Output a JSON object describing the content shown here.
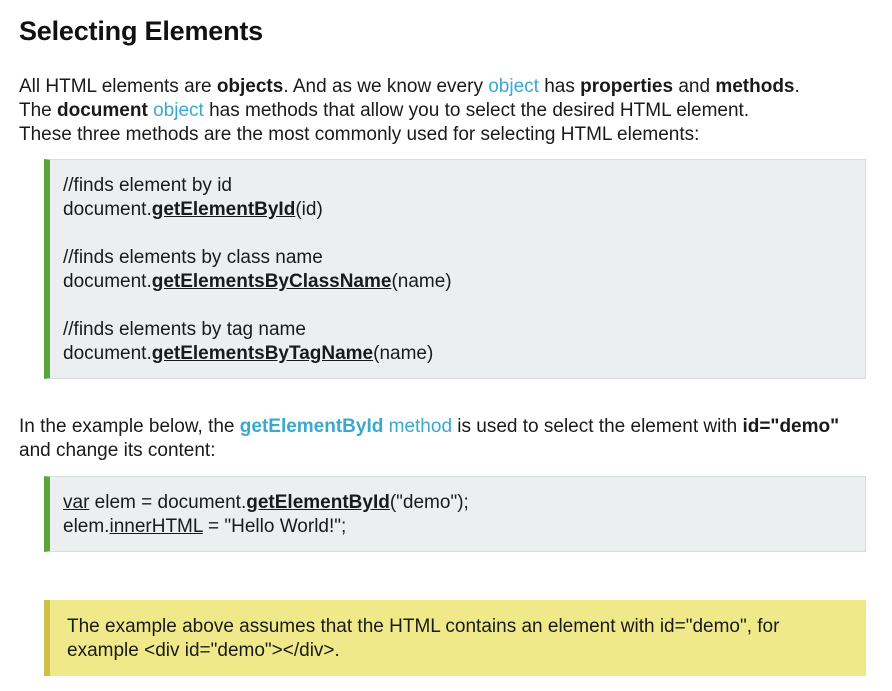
{
  "title": "Selecting Elements",
  "intro": {
    "line1": {
      "t1": "All HTML elements are ",
      "b1": "objects",
      "t2": ". And as we know every ",
      "link1": "object",
      "t3": " has ",
      "b2": "properties",
      "t4": " and ",
      "b3": "methods",
      "t5": "."
    },
    "line2": {
      "t1": "The ",
      "b1": "document",
      "t2": " ",
      "link1": "object",
      "t3": " has methods that allow you to select the desired HTML element."
    },
    "line3": "These three methods are the most commonly used for selecting HTML elements:"
  },
  "code1": {
    "block1": {
      "comment": "//finds element by id",
      "obj": "document.",
      "method": "getElementById",
      "args": "(id)"
    },
    "block2": {
      "comment": "//finds elements by class name",
      "obj": "document.",
      "method": "getElementsByClassName",
      "args": "(name)"
    },
    "block3": {
      "comment": "//finds elements by tag name",
      "obj": "document.",
      "method": "getElementsByTagName",
      "args": "(name)"
    }
  },
  "para2": {
    "t1": "In the example below, the ",
    "link_method": "getElementById",
    "link_word": " method",
    "t2": " is used to select the element with ",
    "b1": "id=\"demo\"",
    "t3": "and change its content:"
  },
  "code2": {
    "line1": {
      "kw": "var",
      "t1": " elem = document.",
      "method": "getElementById",
      "args": "(\"demo\");"
    },
    "line2": {
      "obj": "elem.",
      "prop": "innerHTML",
      "rest": " = \"Hello World!\";"
    }
  },
  "note": {
    "line1": "The example above assumes that the HTML contains an element with id=\"demo\", for",
    "line2": "example <div id=\"demo\"></div>."
  }
}
